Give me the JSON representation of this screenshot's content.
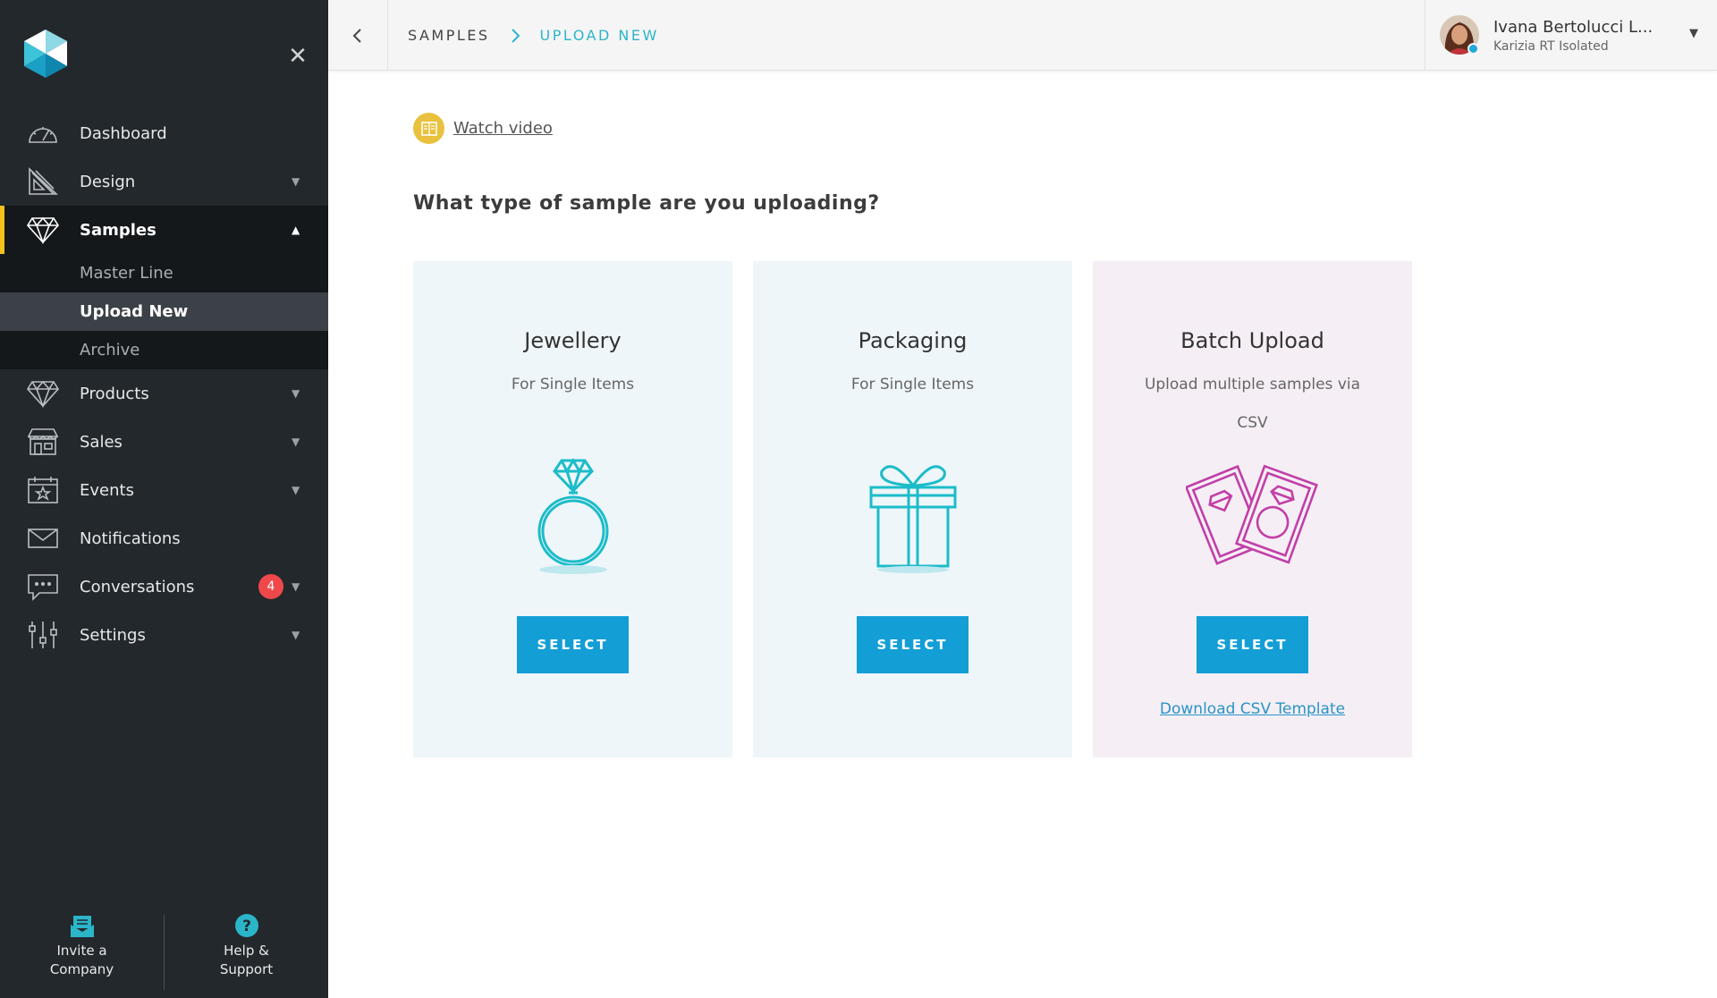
{
  "sidebar": {
    "nav": [
      {
        "label": "Dashboard",
        "icon": "dashboard-icon",
        "caret": ""
      },
      {
        "label": "Design",
        "icon": "design-icon",
        "caret": "▼"
      },
      {
        "label": "Samples",
        "icon": "samples-icon",
        "caret": "▲"
      },
      {
        "label": "Products",
        "icon": "products-icon",
        "caret": "▼"
      },
      {
        "label": "Sales",
        "icon": "sales-icon",
        "caret": "▼"
      },
      {
        "label": "Events",
        "icon": "events-icon",
        "caret": "▼"
      },
      {
        "label": "Notifications",
        "icon": "notifications-icon",
        "caret": ""
      },
      {
        "label": "Conversations",
        "icon": "conversations-icon",
        "caret": "▼",
        "badge": "4"
      },
      {
        "label": "Settings",
        "icon": "settings-icon",
        "caret": "▼"
      }
    ],
    "samples_sub": [
      {
        "label": "Master Line"
      },
      {
        "label": "Upload New"
      },
      {
        "label": "Archive"
      }
    ],
    "footer": {
      "invite_label": "Invite a\nCompany",
      "help_label": "Help &\nSupport"
    },
    "close_glyph": "✕"
  },
  "topbar": {
    "breadcrumb": [
      "SAMPLES",
      "UPLOAD NEW"
    ],
    "user": {
      "name": "Ivana Bertolucci L...",
      "org": "Karizia RT Isolated"
    }
  },
  "main": {
    "watch_video": "Watch video",
    "question": "What type of sample are you uploading?",
    "cards": [
      {
        "title": "Jewellery",
        "subtitle": "For Single Items",
        "button": "SELECT"
      },
      {
        "title": "Packaging",
        "subtitle": "For Single Items",
        "button": "SELECT"
      },
      {
        "title": "Batch Upload",
        "subtitle": "Upload multiple samples via CSV",
        "button": "SELECT",
        "link": "Download CSV Template"
      }
    ]
  },
  "colors": {
    "sidebar_bg": "#23282c",
    "accent_yellow": "#f1c21b",
    "teal": "#2bb5c9",
    "button_blue": "#139ed6",
    "magenta": "#c23fa8",
    "badge_red": "#f0484a"
  }
}
